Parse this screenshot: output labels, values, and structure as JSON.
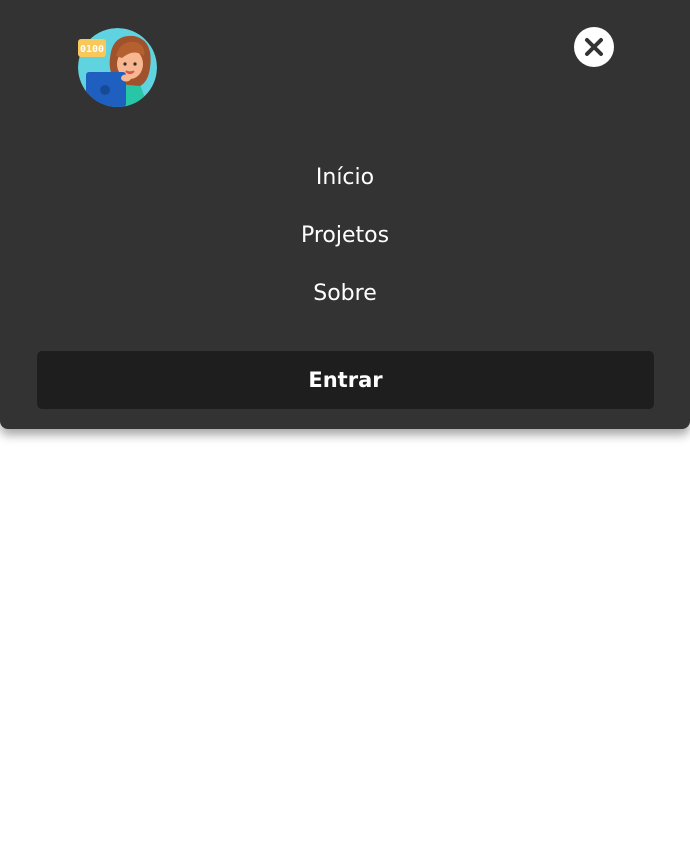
{
  "header": {
    "logo_icon": "developer-avatar-icon",
    "logo_badge_text": "0100",
    "close_icon": "close-icon"
  },
  "nav": {
    "items": [
      {
        "label": "Início"
      },
      {
        "label": "Projetos"
      },
      {
        "label": "Sobre"
      }
    ]
  },
  "login_button": {
    "label": "Entrar"
  },
  "colors": {
    "panel": "#333333",
    "button": "#1e1e1e",
    "text": "#ffffff",
    "page": "#ffffff"
  }
}
